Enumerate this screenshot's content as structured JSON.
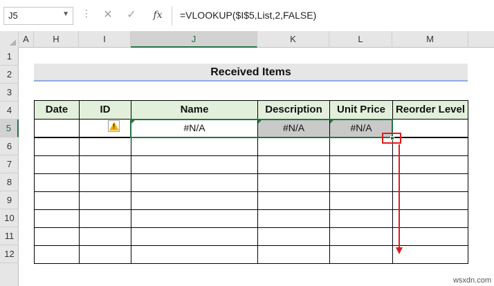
{
  "name_box": {
    "value": "J5"
  },
  "formula_bar": {
    "cancel_icon": "x-icon",
    "enter_icon": "check-icon",
    "fx_label": "fx",
    "formula": "=VLOOKUP($I$5,List,2,FALSE)"
  },
  "columns": [
    "A",
    "H",
    "I",
    "J",
    "K",
    "L",
    "M"
  ],
  "selected_column": "J",
  "rows": [
    "1",
    "2",
    "3",
    "4",
    "5",
    "6",
    "7",
    "8",
    "9",
    "10",
    "11",
    "12"
  ],
  "selected_row": "5",
  "sheet": {
    "title": "Received Items",
    "headers": [
      "Date",
      "ID",
      "Name",
      "Description",
      "Unit Price",
      "Reorder Level"
    ],
    "row5": [
      "",
      "",
      "#N/A",
      "#N/A",
      "#N/A",
      ""
    ]
  },
  "colors": {
    "header_fill": "#e2efda",
    "error_cell_fill": "#c9c9c9",
    "selection": "#217346",
    "annotation": "#e01b1b"
  },
  "watermark": "wsxdn.com"
}
